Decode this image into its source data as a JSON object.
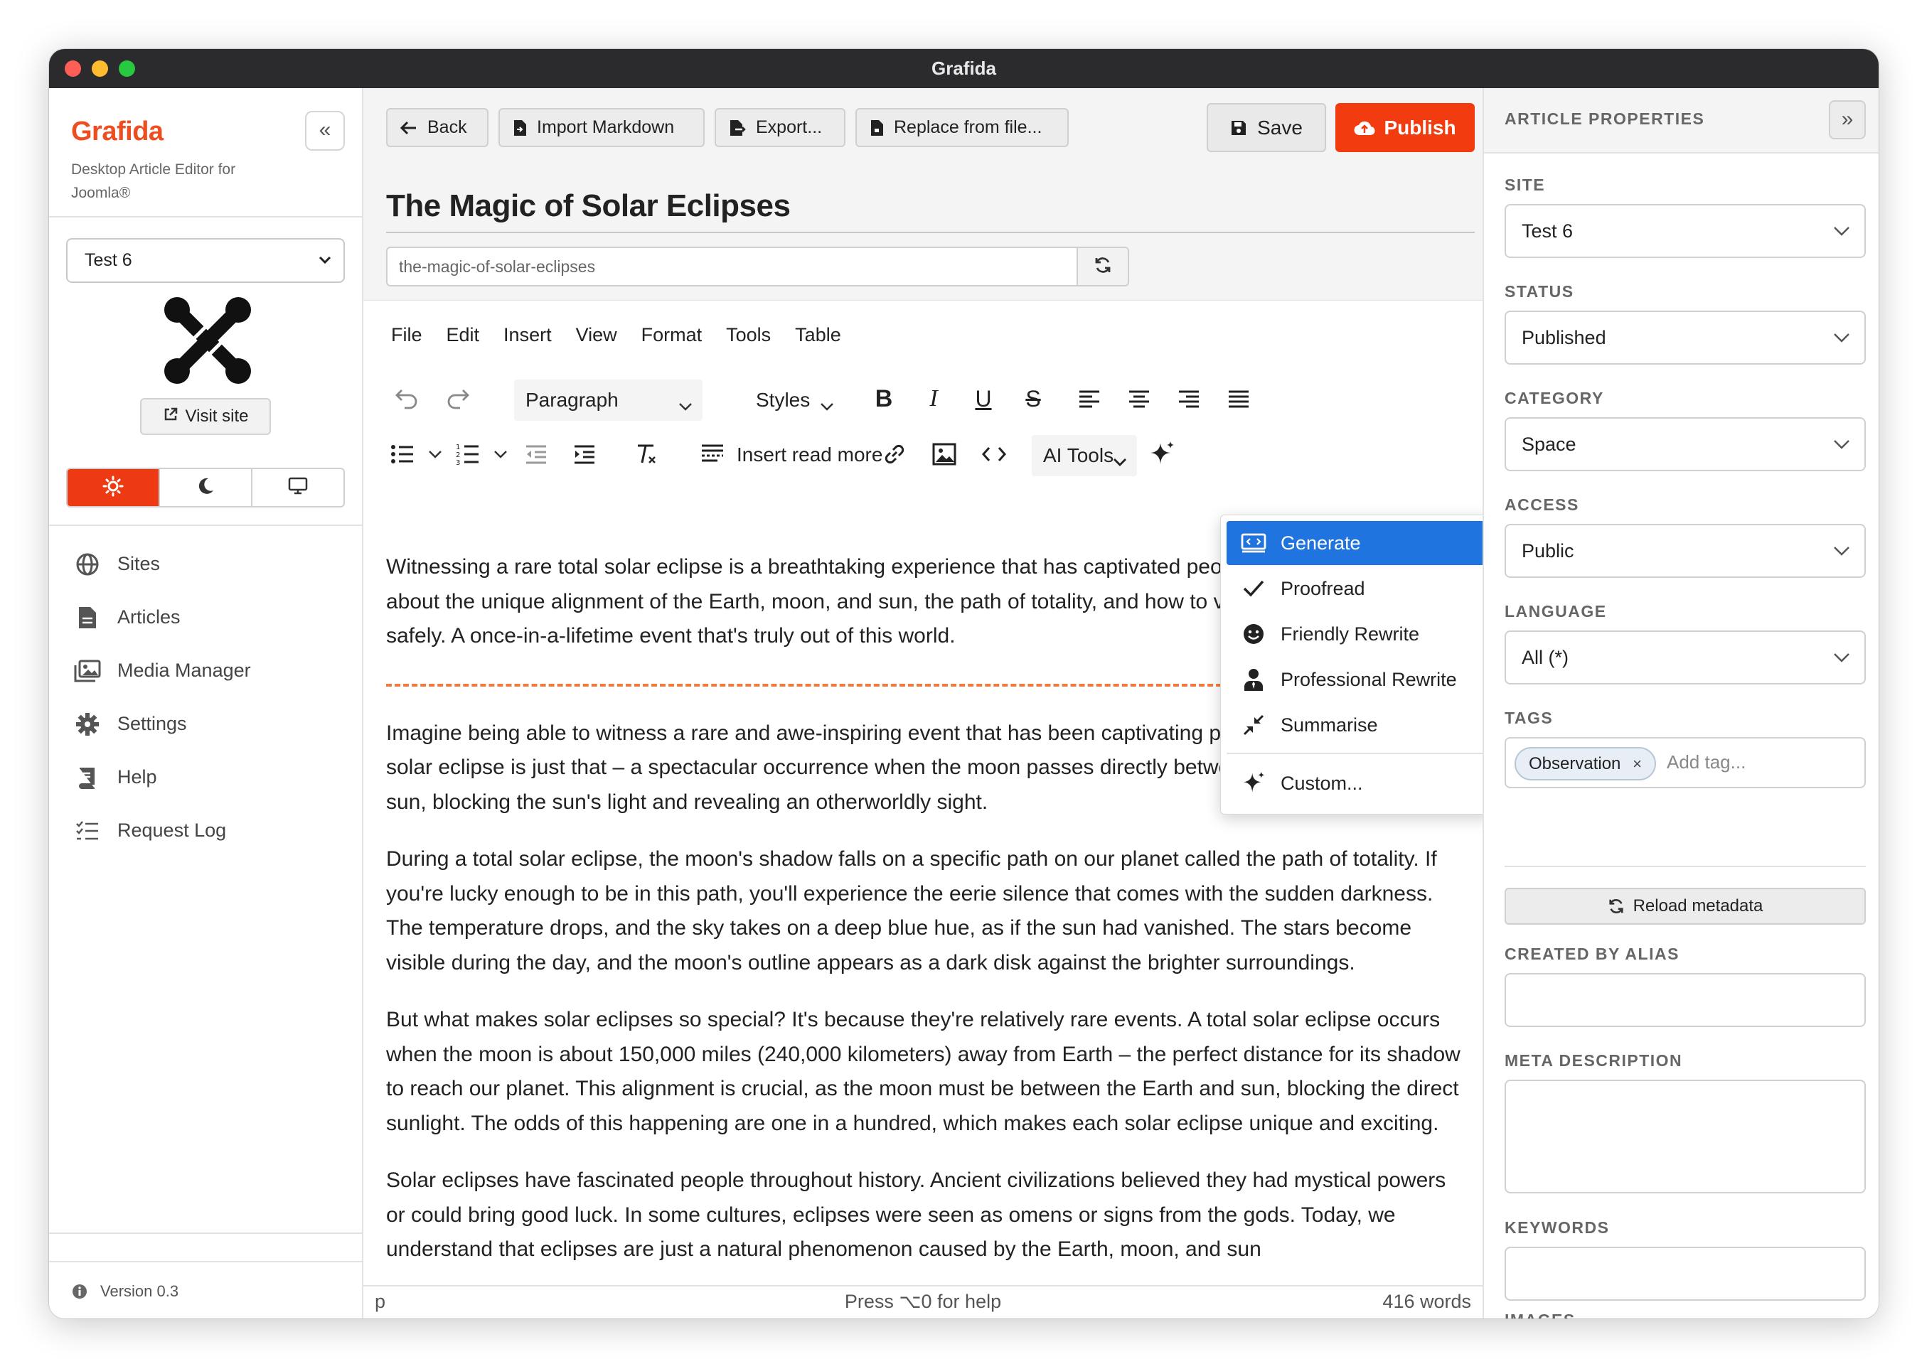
{
  "window": {
    "title": "Grafida"
  },
  "sidebar": {
    "brand": "Grafida",
    "subtitle": "Desktop Article Editor for Joomla®",
    "site_select": "Test 6",
    "visit_site": "Visit site",
    "theme_options": [
      "light",
      "dark",
      "system"
    ],
    "nav": [
      {
        "label": "Sites",
        "icon": "globe-icon"
      },
      {
        "label": "Articles",
        "icon": "document-icon"
      },
      {
        "label": "Media Manager",
        "icon": "images-icon"
      },
      {
        "label": "Settings",
        "icon": "gear-icon"
      },
      {
        "label": "Help",
        "icon": "book-icon"
      },
      {
        "label": "Request Log",
        "icon": "list-check-icon"
      }
    ],
    "version": "Version 0.3"
  },
  "toolbar": {
    "back": "Back",
    "import_markdown": "Import Markdown",
    "export": "Export...",
    "replace_from_file": "Replace from file...",
    "save": "Save",
    "publish": "Publish"
  },
  "article": {
    "title": "The Magic of Solar Eclipses",
    "alias": "the-magic-of-solar-eclipses"
  },
  "editor": {
    "menu": [
      "File",
      "Edit",
      "Insert",
      "View",
      "Format",
      "Tools",
      "Table"
    ],
    "block_format": "Paragraph",
    "styles": "Styles",
    "insert_read_more": "Insert read more",
    "ai_tools": "AI Tools",
    "intro": "Witnessing a rare total solar eclipse is a breathtaking experience that has captivated people for centuries. Learn about the unique alignment of the Earth, moon, and sun, the path of totality, and how to view this celestial wonder safely. A once-in-a-lifetime event that's truly out of this world.",
    "paragraphs": [
      "Imagine being able to witness a rare and awe-inspiring event that has been captivating people for centuries. A solar eclipse is just that – a spectacular occurrence when the moon passes directly between the Earth and the sun, blocking the sun's light and revealing an otherworldly sight.",
      "During a total solar eclipse, the moon's shadow falls on a specific path on our planet called the path of totality. If you're lucky enough to be in this path, you'll experience the eerie silence that comes with the sudden darkness. The temperature drops, and the sky takes on a deep blue hue, as if the sun had vanished. The stars become visible during the day, and the moon's outline appears as a dark disk against the brighter surroundings.",
      "But what makes solar eclipses so special? It's because they're relatively rare events. A total solar eclipse occurs when the moon is about 150,000 miles (240,000 kilometers) away from Earth – the perfect distance for its shadow to reach our planet. This alignment is crucial, as the moon must be between the Earth and sun, blocking the direct sunlight. The odds of this happening are one in a hundred, which makes each solar eclipse unique and exciting.",
      "Solar eclipses have fascinated people throughout history. Ancient civilizations believed they had mystical powers or could bring good luck. In some cultures, eclipses were seen as omens or signs from the gods. Today, we understand that eclipses are just a natural phenomenon caused by the Earth, moon, and sun"
    ],
    "status_path": "p",
    "status_help": "Press ⌥0 for help",
    "status_words": "416 words"
  },
  "ai_menu": {
    "items": [
      {
        "label": "Generate",
        "icon": "generate-icon",
        "active": true
      },
      {
        "label": "Proofread",
        "icon": "check-icon"
      },
      {
        "label": "Friendly Rewrite",
        "icon": "smiley-icon"
      },
      {
        "label": "Professional Rewrite",
        "icon": "person-tie-icon"
      },
      {
        "label": "Summarise",
        "icon": "compress-icon"
      },
      {
        "label": "Custom...",
        "icon": "sparkle-icon"
      }
    ]
  },
  "properties": {
    "title": "ARTICLE PROPERTIES",
    "site_label": "SITE",
    "site_value": "Test 6",
    "status_label": "STATUS",
    "status_value": "Published",
    "category_label": "CATEGORY",
    "category_value": "Space",
    "access_label": "ACCESS",
    "access_value": "Public",
    "language_label": "LANGUAGE",
    "language_value": "All (*)",
    "tags_label": "TAGS",
    "tags": [
      "Observation"
    ],
    "tag_placeholder": "Add tag...",
    "reload_metadata": "Reload metadata",
    "created_by_alias_label": "CREATED BY ALIAS",
    "created_by_alias_value": "",
    "meta_description_label": "META DESCRIPTION",
    "meta_description_value": "",
    "keywords_label": "KEYWORDS",
    "keywords_value": "",
    "images_label": "IMAGES"
  },
  "colors": {
    "brand": "#ee4d1f",
    "publish": "#f23b0e",
    "menu_active": "#1f74e0",
    "readmore_line": "#f07a3c"
  }
}
